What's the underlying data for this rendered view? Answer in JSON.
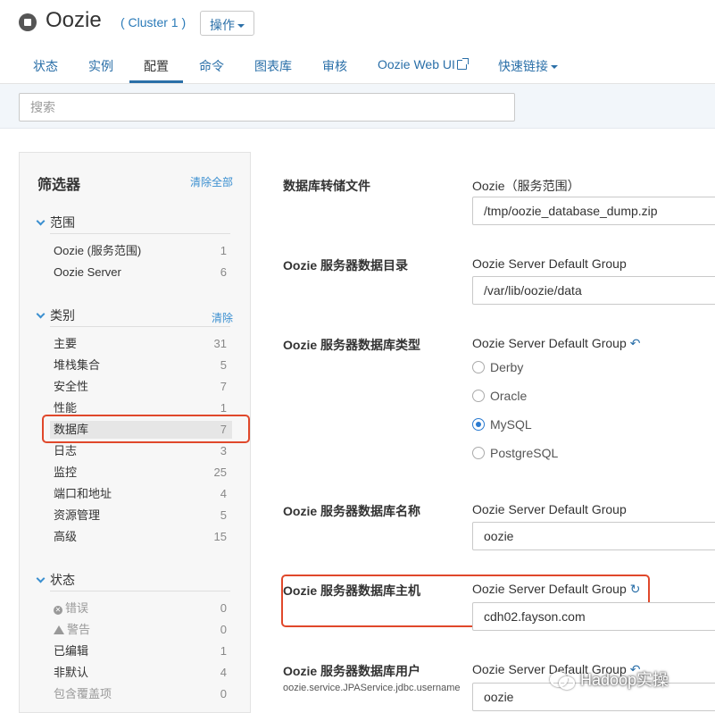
{
  "header": {
    "title": "Oozie",
    "cluster": "( Cluster 1 )",
    "actions_label": "操作"
  },
  "tabs": [
    {
      "label": "状态"
    },
    {
      "label": "实例"
    },
    {
      "label": "配置"
    },
    {
      "label": "命令"
    },
    {
      "label": "图表库"
    },
    {
      "label": "审核"
    },
    {
      "label": "Oozie Web UI"
    },
    {
      "label": "快速链接"
    }
  ],
  "search": {
    "placeholder": "搜索"
  },
  "sidebar": {
    "title": "筛选器",
    "clear_all": "清除全部",
    "scope": {
      "heading": "范围",
      "items": [
        {
          "label": "Oozie (服务范围)",
          "count": "1"
        },
        {
          "label": "Oozie Server",
          "count": "6"
        }
      ]
    },
    "category": {
      "heading": "类别",
      "clear": "清除",
      "items": [
        {
          "label": "主要",
          "count": "31"
        },
        {
          "label": "堆栈集合",
          "count": "5"
        },
        {
          "label": "安全性",
          "count": "7"
        },
        {
          "label": "性能",
          "count": "1"
        },
        {
          "label": "数据库",
          "count": "7"
        },
        {
          "label": "日志",
          "count": "3"
        },
        {
          "label": "监控",
          "count": "25"
        },
        {
          "label": "端口和地址",
          "count": "4"
        },
        {
          "label": "资源管理",
          "count": "5"
        },
        {
          "label": "高级",
          "count": "15"
        }
      ]
    },
    "status": {
      "heading": "状态",
      "items": [
        {
          "label": "错误",
          "count": "0"
        },
        {
          "label": "警告",
          "count": "0"
        },
        {
          "label": "已编辑",
          "count": "1"
        },
        {
          "label": "非默认",
          "count": "4"
        },
        {
          "label": "包含覆盖项",
          "count": "0"
        }
      ]
    }
  },
  "config": [
    {
      "label": "数据库转储文件",
      "scope": "Oozie（服务范围）",
      "value": "/tmp/oozie_database_dump.zip"
    },
    {
      "label": "Oozie 服务器数据目录",
      "scope": "Oozie Server Default Group",
      "value": "/var/lib/oozie/data"
    },
    {
      "label": "Oozie 服务器数据库类型",
      "scope": "Oozie Server Default Group",
      "options": [
        "Derby",
        "Oracle",
        "MySQL",
        "PostgreSQL"
      ],
      "selected": "MySQL"
    },
    {
      "label": "Oozie 服务器数据库名称",
      "scope": "Oozie Server Default Group",
      "value": "oozie"
    },
    {
      "label": "Oozie 服务器数据库主机",
      "scope": "Oozie Server Default Group",
      "value": "cdh02.fayson.com"
    },
    {
      "label": "Oozie 服务器数据库用户",
      "key": "oozie.service.JPAService.jdbc.username",
      "scope": "Oozie Server Default Group",
      "value": "oozie"
    }
  ],
  "watermark": "Hadoop实操",
  "colors": {
    "accent": "#2a6fa8",
    "highlight": "#e0482b",
    "selected_radio": "#2a7ad0"
  }
}
